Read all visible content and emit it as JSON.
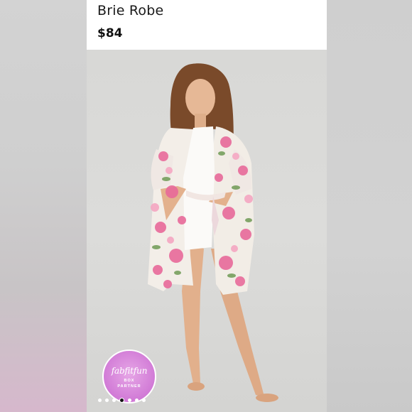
{
  "product": {
    "title": "Brie Robe",
    "price": "$84"
  },
  "badge": {
    "brand": "fabfitfun",
    "line1": "BOX",
    "line2": "PARTNER",
    "color": "#d17ad6"
  },
  "carousel": {
    "total": 7,
    "active_index": 3
  }
}
